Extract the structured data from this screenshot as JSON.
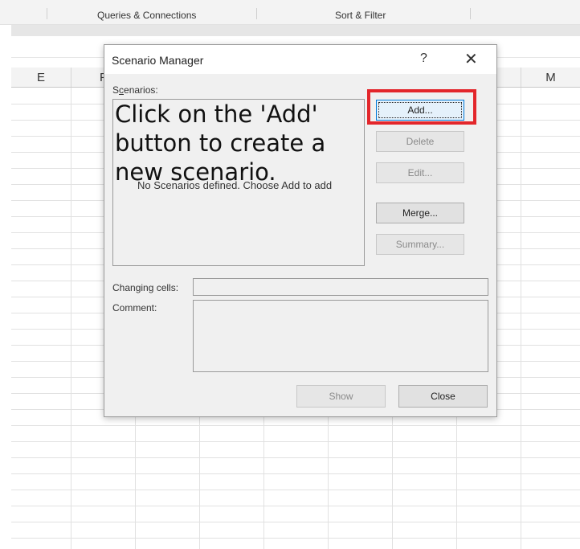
{
  "ribbon": {
    "queries_label": "Queries & Connections",
    "sort_filter_label": "Sort & Filter"
  },
  "columns": [
    "E",
    "F",
    "M"
  ],
  "dialog": {
    "title": "Scenario Manager",
    "help_glyph": "?",
    "close_glyph": "✕",
    "scenarios_label_pre": "S",
    "scenarios_label_underlined": "c",
    "scenarios_label_post": "enarios:",
    "empty_message": "No Scenarios defined. Choose Add to add",
    "overlay_instruction": "Click on the 'Add' button to create a new scenario.",
    "buttons": {
      "add": "Add...",
      "delete": "Delete",
      "edit": "Edit...",
      "merge": "Merge...",
      "summary": "Summary...",
      "show": "Show",
      "close": "Close"
    },
    "changing_cells_label": "Changing cells:",
    "comment_label": "Comment:",
    "changing_cells_value": "",
    "comment_value": ""
  },
  "highlight_color": "#e3262b"
}
